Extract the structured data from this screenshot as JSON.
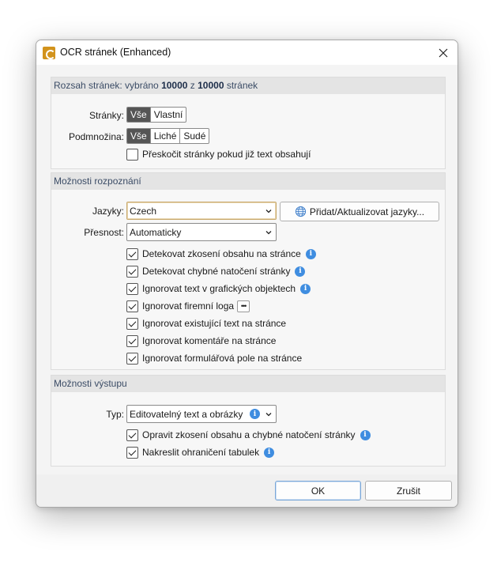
{
  "window": {
    "title": "OCR stránek (Enhanced)",
    "close_icon": "close-icon",
    "app_icon": "app-logo-icon"
  },
  "page_range": {
    "header_prefix": "Rozsah stránek: vybráno ",
    "selected_count": "10000",
    "header_mid": " z ",
    "total_count": "10000",
    "header_suffix": " stránek",
    "pages_label": "Stránky:",
    "pages_options": [
      "Vše",
      "Vlastní"
    ],
    "pages_selected": "Vše",
    "subset_label": "Podmnožina:",
    "subset_options": [
      "Vše",
      "Liché",
      "Sudé"
    ],
    "subset_selected": "Vše",
    "skip_checkbox": {
      "label": "Přeskočit stránky pokud již text obsahují",
      "checked": false
    }
  },
  "recognition": {
    "header": "Možnosti rozpoznání",
    "languages_label": "Jazyky:",
    "languages_value": "Czech",
    "add_languages_button": "Přidat/Aktualizovat jazyky...",
    "accuracy_label": "Přesnost:",
    "accuracy_value": "Automaticky",
    "options": [
      {
        "label": "Detekovat zkosení obsahu na stránce",
        "checked": true,
        "info": true,
        "extra": ""
      },
      {
        "label": "Detekovat chybné natočení stránky",
        "checked": true,
        "info": true,
        "extra": ""
      },
      {
        "label": "Ignorovat text v grafických objektech",
        "checked": true,
        "info": true,
        "extra": ""
      },
      {
        "label": "Ignorovat firemní loga",
        "checked": true,
        "info": false,
        "extra": "more-options"
      },
      {
        "label": "Ignorovat existující text na stránce",
        "checked": true,
        "info": false,
        "extra": ""
      },
      {
        "label": "Ignorovat komentáře na stránce",
        "checked": true,
        "info": false,
        "extra": ""
      },
      {
        "label": "Ignorovat formulářová pole na stránce",
        "checked": true,
        "info": false,
        "extra": ""
      }
    ]
  },
  "output": {
    "header": "Možnosti výstupu",
    "type_label": "Typ:",
    "type_value": "Editovatelný text a obrázky",
    "options": [
      {
        "label": "Opravit zkosení obsahu a chybné natočení stránky",
        "checked": true,
        "info": true
      },
      {
        "label": "Nakreslit ohraničení tabulek",
        "checked": true,
        "info": true
      }
    ]
  },
  "footer": {
    "ok_label": "OK",
    "cancel_label": "Zrušit"
  },
  "colors": {
    "info_icon": "#3f8de0",
    "selected_segment": "#555555",
    "header_text": "#3b4c66"
  }
}
